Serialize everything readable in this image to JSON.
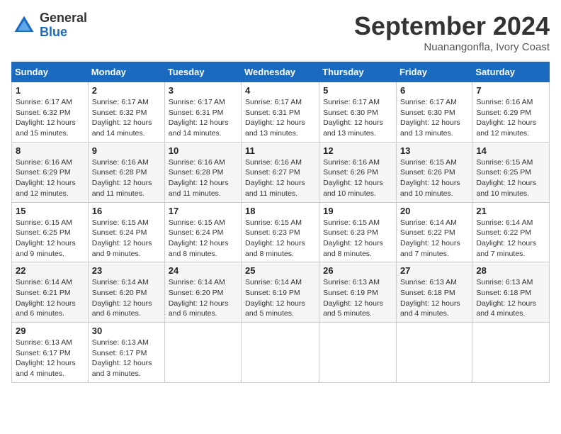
{
  "header": {
    "logo_general": "General",
    "logo_blue": "Blue",
    "month_title": "September 2024",
    "location": "Nuanangonfla, Ivory Coast"
  },
  "days_of_week": [
    "Sunday",
    "Monday",
    "Tuesday",
    "Wednesday",
    "Thursday",
    "Friday",
    "Saturday"
  ],
  "weeks": [
    [
      {
        "day": 1,
        "sunrise": "6:17 AM",
        "sunset": "6:32 PM",
        "daylight": "12 hours and 15 minutes."
      },
      {
        "day": 2,
        "sunrise": "6:17 AM",
        "sunset": "6:32 PM",
        "daylight": "12 hours and 14 minutes."
      },
      {
        "day": 3,
        "sunrise": "6:17 AM",
        "sunset": "6:31 PM",
        "daylight": "12 hours and 14 minutes."
      },
      {
        "day": 4,
        "sunrise": "6:17 AM",
        "sunset": "6:31 PM",
        "daylight": "12 hours and 13 minutes."
      },
      {
        "day": 5,
        "sunrise": "6:17 AM",
        "sunset": "6:30 PM",
        "daylight": "12 hours and 13 minutes."
      },
      {
        "day": 6,
        "sunrise": "6:17 AM",
        "sunset": "6:30 PM",
        "daylight": "12 hours and 13 minutes."
      },
      {
        "day": 7,
        "sunrise": "6:16 AM",
        "sunset": "6:29 PM",
        "daylight": "12 hours and 12 minutes."
      }
    ],
    [
      {
        "day": 8,
        "sunrise": "6:16 AM",
        "sunset": "6:29 PM",
        "daylight": "12 hours and 12 minutes."
      },
      {
        "day": 9,
        "sunrise": "6:16 AM",
        "sunset": "6:28 PM",
        "daylight": "12 hours and 11 minutes."
      },
      {
        "day": 10,
        "sunrise": "6:16 AM",
        "sunset": "6:28 PM",
        "daylight": "12 hours and 11 minutes."
      },
      {
        "day": 11,
        "sunrise": "6:16 AM",
        "sunset": "6:27 PM",
        "daylight": "12 hours and 11 minutes."
      },
      {
        "day": 12,
        "sunrise": "6:16 AM",
        "sunset": "6:26 PM",
        "daylight": "12 hours and 10 minutes."
      },
      {
        "day": 13,
        "sunrise": "6:15 AM",
        "sunset": "6:26 PM",
        "daylight": "12 hours and 10 minutes."
      },
      {
        "day": 14,
        "sunrise": "6:15 AM",
        "sunset": "6:25 PM",
        "daylight": "12 hours and 10 minutes."
      }
    ],
    [
      {
        "day": 15,
        "sunrise": "6:15 AM",
        "sunset": "6:25 PM",
        "daylight": "12 hours and 9 minutes."
      },
      {
        "day": 16,
        "sunrise": "6:15 AM",
        "sunset": "6:24 PM",
        "daylight": "12 hours and 9 minutes."
      },
      {
        "day": 17,
        "sunrise": "6:15 AM",
        "sunset": "6:24 PM",
        "daylight": "12 hours and 8 minutes."
      },
      {
        "day": 18,
        "sunrise": "6:15 AM",
        "sunset": "6:23 PM",
        "daylight": "12 hours and 8 minutes."
      },
      {
        "day": 19,
        "sunrise": "6:15 AM",
        "sunset": "6:23 PM",
        "daylight": "12 hours and 8 minutes."
      },
      {
        "day": 20,
        "sunrise": "6:14 AM",
        "sunset": "6:22 PM",
        "daylight": "12 hours and 7 minutes."
      },
      {
        "day": 21,
        "sunrise": "6:14 AM",
        "sunset": "6:22 PM",
        "daylight": "12 hours and 7 minutes."
      }
    ],
    [
      {
        "day": 22,
        "sunrise": "6:14 AM",
        "sunset": "6:21 PM",
        "daylight": "12 hours and 6 minutes."
      },
      {
        "day": 23,
        "sunrise": "6:14 AM",
        "sunset": "6:20 PM",
        "daylight": "12 hours and 6 minutes."
      },
      {
        "day": 24,
        "sunrise": "6:14 AM",
        "sunset": "6:20 PM",
        "daylight": "12 hours and 6 minutes."
      },
      {
        "day": 25,
        "sunrise": "6:14 AM",
        "sunset": "6:19 PM",
        "daylight": "12 hours and 5 minutes."
      },
      {
        "day": 26,
        "sunrise": "6:13 AM",
        "sunset": "6:19 PM",
        "daylight": "12 hours and 5 minutes."
      },
      {
        "day": 27,
        "sunrise": "6:13 AM",
        "sunset": "6:18 PM",
        "daylight": "12 hours and 4 minutes."
      },
      {
        "day": 28,
        "sunrise": "6:13 AM",
        "sunset": "6:18 PM",
        "daylight": "12 hours and 4 minutes."
      }
    ],
    [
      {
        "day": 29,
        "sunrise": "6:13 AM",
        "sunset": "6:17 PM",
        "daylight": "12 hours and 4 minutes."
      },
      {
        "day": 30,
        "sunrise": "6:13 AM",
        "sunset": "6:17 PM",
        "daylight": "12 hours and 3 minutes."
      },
      null,
      null,
      null,
      null,
      null
    ]
  ]
}
